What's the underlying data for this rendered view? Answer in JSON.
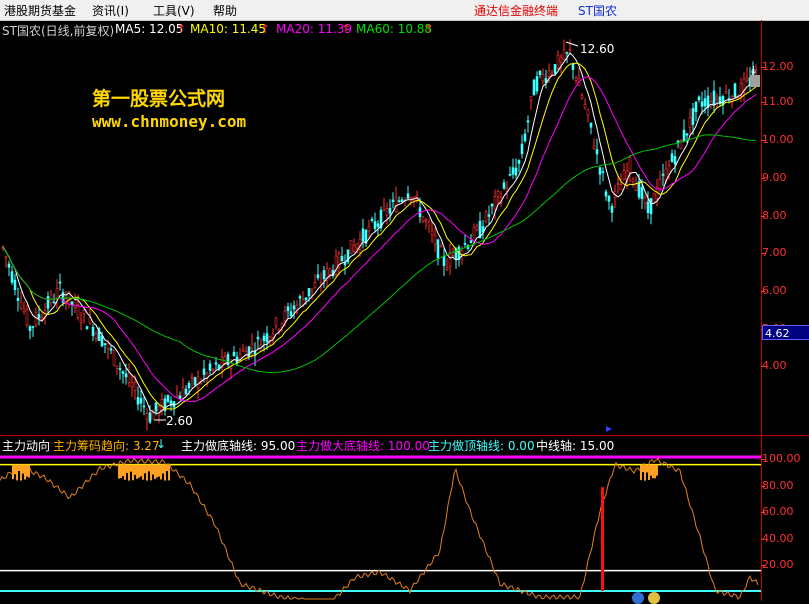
{
  "menu": {
    "items": [
      "港股期货基金",
      "资讯(I)",
      "工具(V)",
      "帮助"
    ],
    "brand": "通达信金融终端",
    "stock": "ST国农"
  },
  "header": {
    "title": "ST国农(日线,前复权)",
    "ma5": "MA5: 12.05",
    "ma10": "MA10: 11.45",
    "ma20": "MA20: 11.39",
    "ma60": "MA60: 10.88",
    "up_arrow": "↑"
  },
  "watermark": {
    "line1": "第一股票公式网",
    "line2": "www.chnmoney.com"
  },
  "price_chart": {
    "high_label": "12.60",
    "low_label": "2.60",
    "cursor_value": "4.62",
    "yticks": [
      "12.00",
      "11.00",
      "10.00",
      "9.00",
      "8.00",
      "7.00",
      "6.00",
      "5.00",
      "4.00"
    ],
    "colors": {
      "up": "#ff3030",
      "down": "#40ffff",
      "ma5": "#ffffff",
      "ma10": "#ffff00",
      "ma20": "#ff00ff",
      "ma60": "#00c000"
    }
  },
  "sub_chart": {
    "name": "主力动向",
    "trend": "主力筹码趋向: 3.27",
    "trend_arrow": "↓",
    "bottom_line": "主力做底轴线: 95.00",
    "big_bottom_line": "主力做大底轴线: 100.00",
    "top_line": "主力做顶轴线: 0.00",
    "mid_line": "中线轴: 15.00",
    "yticks": [
      "100.00",
      "80.00",
      "60.00",
      "40.00",
      "20.00"
    ]
  }
}
